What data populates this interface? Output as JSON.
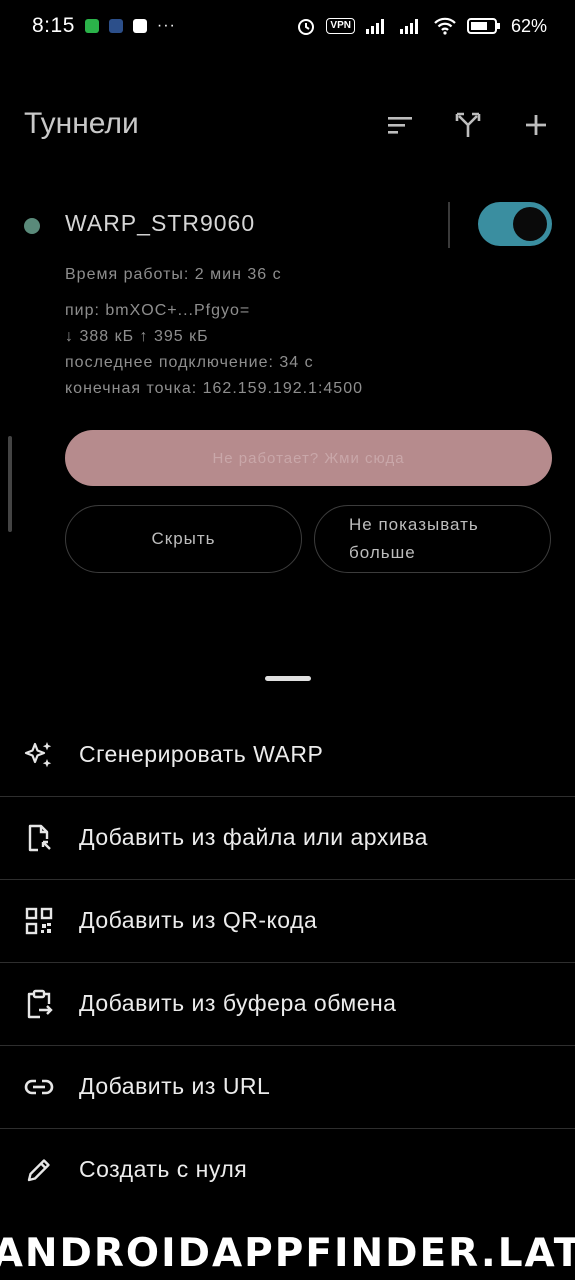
{
  "status_bar": {
    "time": "8:15",
    "dots": "···",
    "vpn": "VPN",
    "battery": "62%"
  },
  "header": {
    "title": "Туннели"
  },
  "tunnel": {
    "name": "WARP_STR9060",
    "enabled": true,
    "uptime": "Время работы: 2 мин 36 с",
    "peer": "пир: bmXOC+...Pfgyo=",
    "traffic": "↓ 388 кБ   ↑ 395 кБ",
    "last_handshake": "последнее подключение: 34 с",
    "endpoint": "конечная точка: 162.159.192.1:4500",
    "broken_button": "Не работает? Жми сюда",
    "hide_button": "Скрыть",
    "dont_show_line1": "Не показывать",
    "dont_show_line2": "больше"
  },
  "colors": {
    "accent": "#3a8ea0",
    "status_dot": "#5a8a7a",
    "broken_button_bg": "#b68b8d"
  },
  "sheet": {
    "items": [
      {
        "label": "Сгенерировать WARP",
        "icon": "sparkle-icon"
      },
      {
        "label": "Добавить из файла или архива",
        "icon": "file-import-icon"
      },
      {
        "label": "Добавить из QR-кода",
        "icon": "qr-code-icon"
      },
      {
        "label": "Добавить из буфера обмена",
        "icon": "clipboard-icon"
      },
      {
        "label": "Добавить из URL",
        "icon": "link-icon"
      },
      {
        "label": "Создать с нуля",
        "icon": "pencil-icon"
      }
    ]
  },
  "watermark": "ANDROIDAPPFINDER.LAT"
}
